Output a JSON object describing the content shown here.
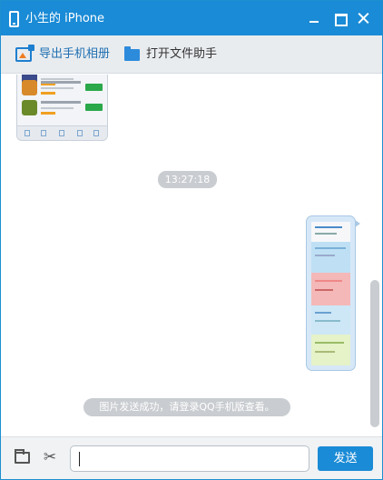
{
  "window": {
    "title": "小生的 iPhone"
  },
  "toolbar": {
    "export_label": "导出手机相册",
    "open_folder_label": "打开文件助手"
  },
  "chat": {
    "timestamp": "13:27:18",
    "notice": "图片发送成功，请登录QQ手机版查看。"
  },
  "input": {
    "value": "",
    "send_label": "发送"
  },
  "colors": {
    "accent": "#1a8bd6",
    "toolbar_bg": "#e9ecef",
    "pill_bg": "#c9ccd0"
  },
  "icons": [
    "phone-icon",
    "minimize-icon",
    "maximize-icon",
    "close-icon",
    "export-photo-icon",
    "folder-icon",
    "scissors-icon"
  ]
}
